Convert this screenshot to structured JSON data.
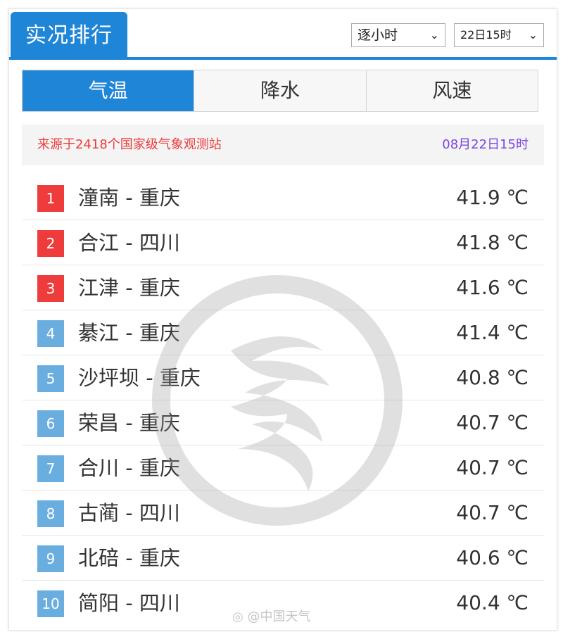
{
  "header": {
    "title": "实况排行",
    "interval_select": "逐小时",
    "time_select": "22日15时"
  },
  "tabs": [
    {
      "label": "气温",
      "active": true
    },
    {
      "label": "降水",
      "active": false
    },
    {
      "label": "风速",
      "active": false
    }
  ],
  "info": {
    "source": "来源于2418个国家级气象观测站",
    "time": "08月22日15时"
  },
  "ranking": [
    {
      "rank": "1",
      "station": "潼南 - 重庆",
      "temp": "41.9 ℃"
    },
    {
      "rank": "2",
      "station": "合江 - 四川",
      "temp": "41.8 ℃"
    },
    {
      "rank": "3",
      "station": "江津 - 重庆",
      "temp": "41.6 ℃"
    },
    {
      "rank": "4",
      "station": "綦江 - 重庆",
      "temp": "41.4 ℃"
    },
    {
      "rank": "5",
      "station": "沙坪坝 - 重庆",
      "temp": "40.8 ℃"
    },
    {
      "rank": "6",
      "station": "荣昌 - 重庆",
      "temp": "40.7 ℃"
    },
    {
      "rank": "7",
      "station": "合川 - 重庆",
      "temp": "40.7 ℃"
    },
    {
      "rank": "8",
      "station": "古蔺 - 四川",
      "temp": "40.7 ℃"
    },
    {
      "rank": "9",
      "station": "北碚 - 重庆",
      "temp": "40.6 ℃"
    },
    {
      "rank": "10",
      "station": "简阳 - 四川",
      "temp": "40.4 ℃"
    }
  ],
  "watermark_text": "@中国天气",
  "colors": {
    "accent": "#1f85d7",
    "top_rank": "#ee3b3b",
    "other_rank": "#6aaee0",
    "source_text": "#ee3b3b",
    "time_text": "#7a46e0"
  },
  "icons": {
    "select_arrow": "chevron-down-icon",
    "watermark": "china-weather-logo-icon",
    "weibo": "weibo-icon"
  }
}
